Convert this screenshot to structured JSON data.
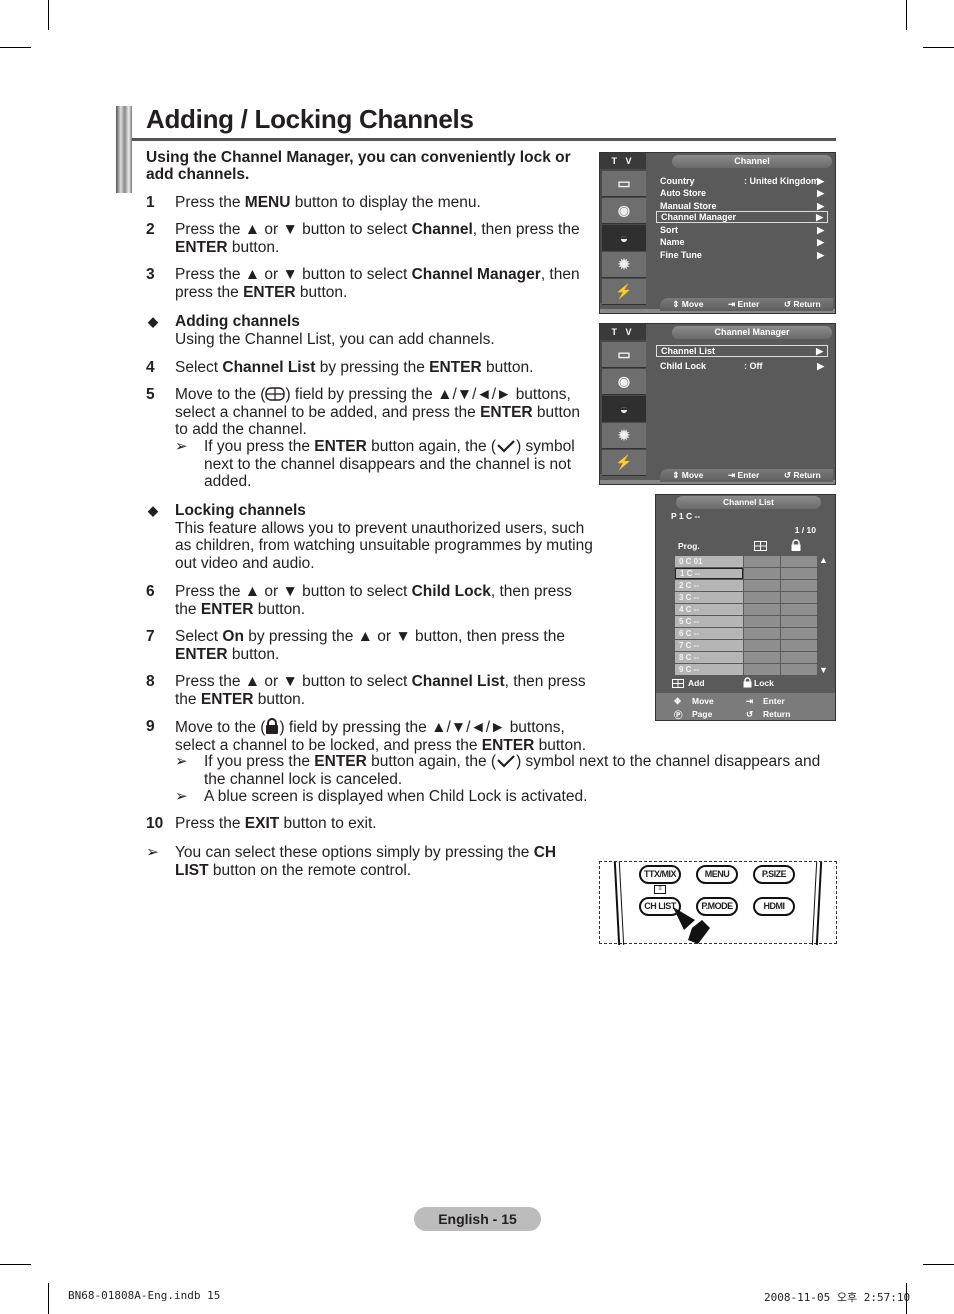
{
  "title": "Adding / Locking Channels",
  "intro": "Using the Channel Manager, you can conveniently lock or add channels.",
  "steps": {
    "s1": {
      "num": "1",
      "pre": "Press the ",
      "b1": "MENU",
      "post": " button to display the menu."
    },
    "s2": {
      "num": "2",
      "pre": "Press the ▲ or ▼ button to select ",
      "b1": "Channel",
      "mid": ", then press the ",
      "b2": "ENTER",
      "post": " button."
    },
    "s3": {
      "num": "3",
      "pre": "Press the ▲ or ▼ button to select ",
      "b1": "Channel Manager",
      "mid": ", then press the ",
      "b2": "ENTER",
      "post": " button."
    },
    "adding": {
      "bullet": "◆",
      "heading": "Adding channels",
      "text": "Using the Channel List, you can add channels."
    },
    "s4": {
      "num": "4",
      "pre": "Select ",
      "b1": "Channel List",
      "mid": " by pressing the ",
      "b2": "ENTER",
      "post": " button."
    },
    "s5": {
      "num": "5",
      "pre": "Move to the (",
      "mid1": ") field by pressing the ▲/▼/◄/► buttons, select a channel to be added, and press the ",
      "b1": "ENTER",
      "post": " button to add the channel."
    },
    "n5": {
      "arrow": "➢",
      "pre": "If you press the ",
      "b1": "ENTER",
      "mid": " button again, the (",
      "post": ") symbol next to the channel disappears and the channel is not added."
    },
    "locking": {
      "bullet": "◆",
      "heading": "Locking channels",
      "text": "This feature allows you to prevent unauthorized users, such as children, from watching unsuitable programmes by muting out video and audio."
    },
    "s6": {
      "num": "6",
      "pre": "Press the ▲ or ▼ button to select ",
      "b1": "Child Lock",
      "mid": ", then press the ",
      "b2": "ENTER",
      "post": " button."
    },
    "s7": {
      "num": "7",
      "pre": "Select ",
      "b1": "On",
      "mid": " by pressing the ▲ or ▼ button, then press the ",
      "b2": "ENTER",
      "post": " button."
    },
    "s8": {
      "num": "8",
      "pre": "Press the ▲ or ▼ button to select ",
      "b1": "Channel List",
      "mid": ", then press the ",
      "b2": "ENTER",
      "post": " button."
    },
    "s9": {
      "num": "9",
      "pre": "Move to the (",
      "mid1": ") field by pressing the ▲/▼/◄/► buttons,",
      "line2": "select a channel to be locked, and press the ",
      "b1": "ENTER",
      "post": " button."
    },
    "n9a": {
      "arrow": "➢",
      "pre": "If you press the ",
      "b1": "ENTER",
      "mid": " button again, the (",
      "post": ") symbol next to the channel disappears and the channel lock is canceled."
    },
    "n9b": {
      "arrow": "➢",
      "text": "A blue screen is displayed when Child Lock is activated."
    },
    "s10": {
      "num": "10",
      "pre": "Press the ",
      "b1": "EXIT",
      "post": " button to exit."
    },
    "final": {
      "arrow": "➢",
      "pre": "You can select these options simply by pressing the ",
      "b1": "CH LIST",
      "post": " button on the remote control."
    }
  },
  "osd1": {
    "tab": "T V",
    "header": "Channel",
    "items": [
      {
        "label": "Country",
        "value": ": United Kingdom",
        "arrow": "▶"
      },
      {
        "label": "Auto Store",
        "value": "",
        "arrow": "▶"
      },
      {
        "label": "Manual Store",
        "value": "",
        "arrow": "▶"
      },
      {
        "label": "Channel Manager",
        "value": "",
        "arrow": "▶",
        "selected": true
      },
      {
        "label": "Sort",
        "value": "",
        "arrow": "▶"
      },
      {
        "label": "Name",
        "value": "",
        "arrow": "▶"
      },
      {
        "label": "Fine Tune",
        "value": "",
        "arrow": "▶"
      }
    ],
    "footer": {
      "move": "Move",
      "enter": "Enter",
      "return": "Return"
    }
  },
  "osd2": {
    "tab": "T V",
    "header": "Channel Manager",
    "items": [
      {
        "label": "Channel List",
        "value": "",
        "arrow": "▶",
        "selected": true
      },
      {
        "label": "Child Lock",
        "value": ": Off",
        "arrow": "▶"
      }
    ],
    "footer": {
      "move": "Move",
      "enter": "Enter",
      "return": "Return"
    }
  },
  "channel_list": {
    "header": "Channel List",
    "current": "P  1    C --",
    "page": "1 / 10",
    "prog_label": "Prog.",
    "rows": [
      {
        "prog": "0",
        "ch": "C 01"
      },
      {
        "prog": "1",
        "ch": "C --",
        "selected": true
      },
      {
        "prog": "2",
        "ch": "C --"
      },
      {
        "prog": "3",
        "ch": "C --"
      },
      {
        "prog": "4",
        "ch": "C --"
      },
      {
        "prog": "5",
        "ch": "C --"
      },
      {
        "prog": "6",
        "ch": "C --"
      },
      {
        "prog": "7",
        "ch": "C --"
      },
      {
        "prog": "8",
        "ch": "C --"
      },
      {
        "prog": "9",
        "ch": "C --"
      }
    ],
    "legend": {
      "add": "Add",
      "lock": "Lock"
    },
    "footer": {
      "move": "Move",
      "enter": "Enter",
      "page": "Page",
      "return": "Return"
    }
  },
  "remote": {
    "buttons": [
      "TTX/MIX",
      "MENU",
      "P.SIZE",
      "CH LIST",
      "P.MODE",
      "HDMI"
    ]
  },
  "page_number": "English - 15",
  "slug_left": "BN68-01808A-Eng.indb   15",
  "slug_right": "2008-11-05   오후 2:57:10"
}
